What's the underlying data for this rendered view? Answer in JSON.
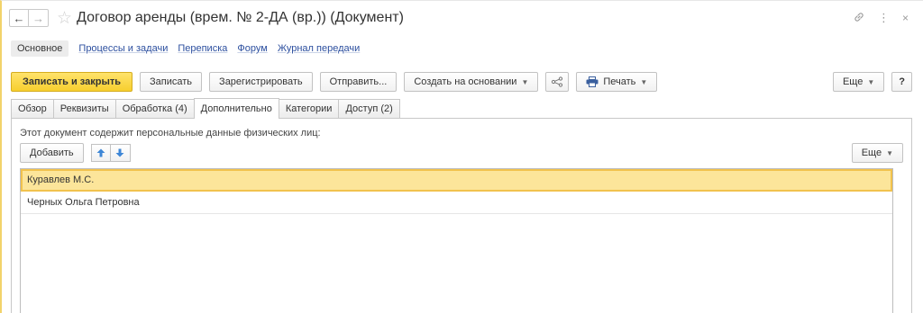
{
  "window": {
    "title": "Договор аренды (врем. № 2-ДА (вр.)) (Документ)",
    "back_icon": "arrow-left-icon",
    "forward_icon": "arrow-right-icon",
    "favorite_icon": "star-icon",
    "link_icon": "link-icon",
    "more_icon": "vertical-dots-icon",
    "close_icon": "close-icon"
  },
  "nav": {
    "active": "Основное",
    "links": [
      "Процессы и задачи",
      "Переписка",
      "Форум",
      "Журнал передачи"
    ]
  },
  "toolbar": {
    "save_close": "Записать и закрыть",
    "save": "Записать",
    "register": "Зарегистрировать",
    "send": "Отправить...",
    "create_based": "Создать на основании",
    "print": "Печать",
    "more": "Еще",
    "help": "?"
  },
  "tabs": [
    {
      "label": "Обзор",
      "active": false
    },
    {
      "label": "Реквизиты",
      "active": false
    },
    {
      "label": "Обработка (4)",
      "active": false
    },
    {
      "label": "Дополнительно",
      "active": true
    },
    {
      "label": "Категории",
      "active": false
    },
    {
      "label": "Доступ (2)",
      "active": false
    }
  ],
  "panel": {
    "note": "Этот документ содержит персональные данные физических лиц:",
    "add": "Добавить",
    "more": "Еще"
  },
  "list": {
    "rows": [
      {
        "name": "Куравлев М.С.",
        "selected": true
      },
      {
        "name": "Черных Ольга Петровна",
        "selected": false
      }
    ]
  },
  "colors": {
    "accent_yellow": "#f7cf2e",
    "selection": "#fce59a",
    "link_blue": "#2c4f9f",
    "arrow_blue": "#3d86d6"
  }
}
